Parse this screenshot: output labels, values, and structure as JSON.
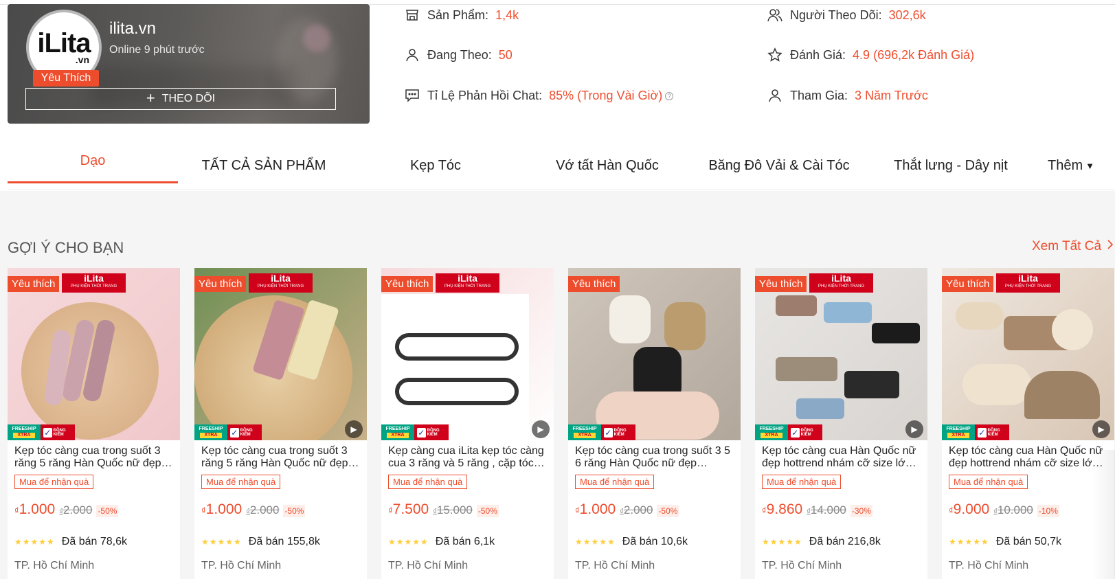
{
  "shop": {
    "avatar_logo": "iLita",
    "avatar_logo_sub": ".vn",
    "favorite_badge": "Yêu Thích",
    "name": "ilita.vn",
    "status": "Online 9 phút trước",
    "follow_label": "THEO DÕI"
  },
  "stats": {
    "products_label": "Sản Phẩm:",
    "products_value": "1,4k",
    "following_label": "Đang Theo:",
    "following_value": "50",
    "chat_label": "Tỉ Lệ Phản Hồi Chat:",
    "chat_value": "85% (Trong Vài Giờ)",
    "followers_label": "Người Theo Dõi:",
    "followers_value": "302,6k",
    "rating_label": "Đánh Giá:",
    "rating_value": "4.9 (696,2k Đánh Giá)",
    "joined_label": "Tham Gia:",
    "joined_value": "3 Năm Trước"
  },
  "tabs": [
    {
      "label": "Dạo"
    },
    {
      "label": "TẤT CẢ SẢN PHẨM"
    },
    {
      "label": "Kẹp Tóc"
    },
    {
      "label": "Vớ tất Hàn Quốc"
    },
    {
      "label": "Băng Đô Vải & Cài Tóc"
    },
    {
      "label": "Thắt lưng - Dây nịt"
    },
    {
      "label": "Thêm"
    }
  ],
  "section": {
    "title": "GỢI Ý CHO BẠN",
    "see_all": "Xem Tất Cả"
  },
  "common": {
    "fav": "Yêu thích",
    "brand_main": "iLita",
    "brand_sub": "PHỤ KIỆN THỜI TRANG",
    "freeship": "FREESHIP",
    "xtra": "XTRA",
    "dongkiem": "ĐỒNG KIỂM",
    "promo": "Mua để nhận quà",
    "currency": "₫"
  },
  "products": [
    {
      "name": "Kẹp tóc càng cua trong suốt 3 răng 5 răng Hàn Quốc nữ đẹp hottrend",
      "price": "1.000",
      "old_price": "2.000",
      "discount": "-50%",
      "sold": "Đã bán 78,6k",
      "location": "TP. Hồ Chí Minh"
    },
    {
      "name": "Kẹp tóc càng cua trong suốt 3 răng 5 răng Hàn Quốc nữ đẹp hottrend",
      "price": "1.000",
      "old_price": "2.000",
      "discount": "-50%",
      "sold": "Đã bán 155,8k",
      "location": "TP. Hồ Chí Minh"
    },
    {
      "name": "Kẹp càng cua iLita kẹp tóc càng cua 3 răng và 5 răng , cặp tóc nữ",
      "price": "7.500",
      "old_price": "15.000",
      "discount": "-50%",
      "sold": "Đã bán 6,1k",
      "location": "TP. Hồ Chí Minh"
    },
    {
      "name": "Kẹp tóc càng cua trong suốt 3 5 6 răng Hàn Quốc nữ đẹp hottrend",
      "price": "1.000",
      "old_price": "2.000",
      "discount": "-50%",
      "sold": "Đã bán 10,6k",
      "location": "TP. Hồ Chí Minh"
    },
    {
      "name": "Kẹp tóc càng cua Hàn Quốc nữ đẹp hottrend nhám cỡ size lớn to",
      "price": "9.860",
      "old_price": "14.000",
      "discount": "-30%",
      "sold": "Đã bán 216,8k",
      "location": "TP. Hồ Chí Minh"
    },
    {
      "name": "Kẹp tóc càng cua Hàn Quốc nữ đẹp hottrend nhám cỡ size lớn to",
      "price": "9.000",
      "old_price": "10.000",
      "discount": "-10%",
      "sold": "Đã bán 50,7k",
      "location": "TP. Hồ Chí Minh"
    }
  ],
  "colors": {
    "accent": "#ee4d2d",
    "star": "#ffce3d",
    "brand_red": "#d0021b",
    "freeship_green": "#00a383"
  }
}
